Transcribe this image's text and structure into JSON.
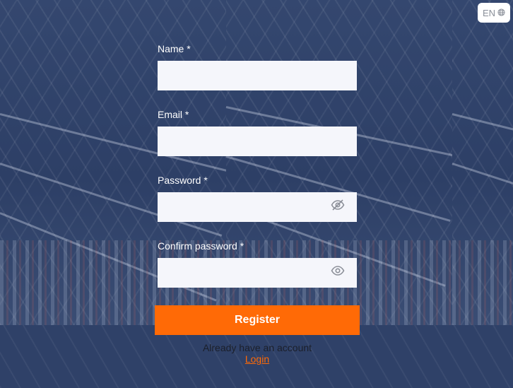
{
  "language": {
    "code": "EN",
    "icon": "globe-icon"
  },
  "form": {
    "fields": [
      {
        "label": "Name *",
        "value": "",
        "type": "text"
      },
      {
        "label": "Email *",
        "value": "",
        "type": "email"
      },
      {
        "label": "Password *",
        "value": "",
        "type": "password",
        "toggle_icon": "eye-slash-icon"
      },
      {
        "label": "Confirm password *",
        "value": "",
        "type": "password",
        "toggle_icon": "eye-icon"
      }
    ],
    "submit_label": "Register"
  },
  "footer": {
    "prompt": "Already have an account",
    "login_label": "Login"
  },
  "colors": {
    "accent": "#ff6a06",
    "background": "#2f4168",
    "input_background": "#f5f6fb"
  }
}
